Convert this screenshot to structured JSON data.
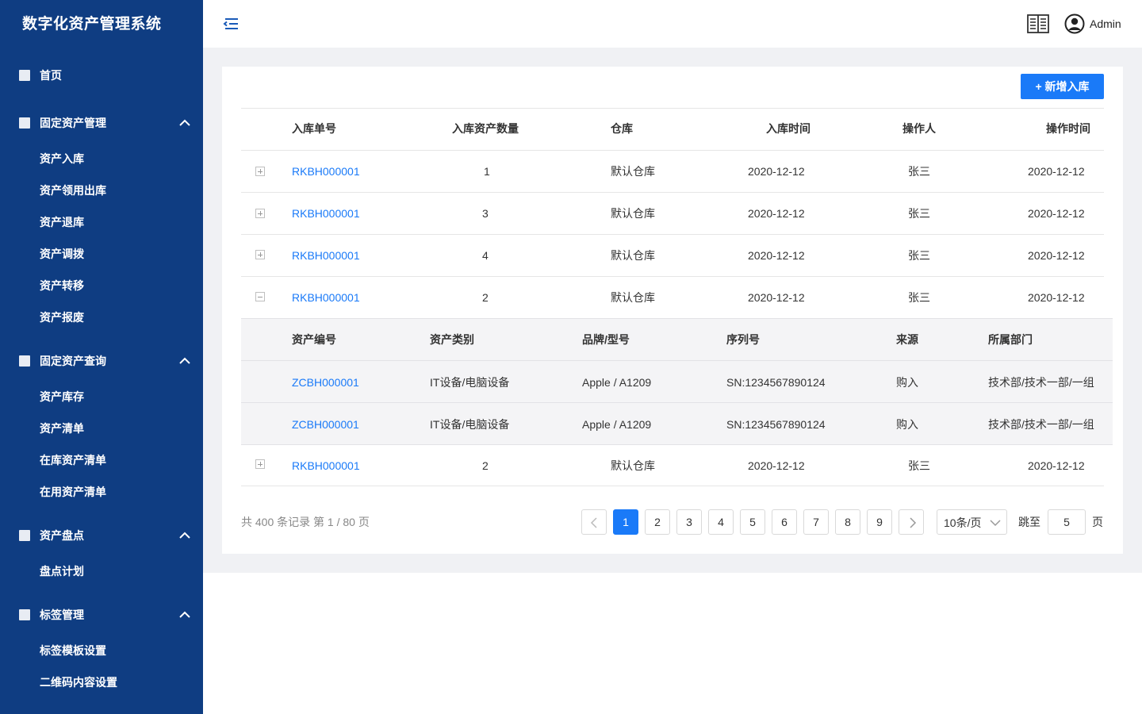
{
  "app": {
    "title": "数字化资产管理系统"
  },
  "sidebar": {
    "home": "首页",
    "groups": [
      {
        "label": "固定资产管理",
        "items": [
          "资产入库",
          "资产领用出库",
          "资产退库",
          "资产调拨",
          "资产转移",
          "资产报废"
        ]
      },
      {
        "label": "固定资产查询",
        "items": [
          "资产库存",
          "资产清单",
          "在库资产清单",
          "在用资产清单"
        ]
      },
      {
        "label": "资产盘点",
        "items": [
          "盘点计划"
        ]
      },
      {
        "label": "标签管理",
        "items": [
          "标签模板设置",
          "二维码内容设置"
        ]
      }
    ]
  },
  "header": {
    "user": "Admin",
    "icons": [
      "menu-collapse-icon",
      "book-icon",
      "user-avatar-icon"
    ]
  },
  "toolbar": {
    "add_label": "+  新增入库"
  },
  "table": {
    "columns": [
      "入库单号",
      "入库资产数量",
      "仓库",
      "入库时间",
      "操作人",
      "操作时间"
    ],
    "rows": [
      {
        "id": "RKBH000001",
        "qty": "1",
        "warehouse": "默认仓库",
        "in_time": "2020-12-12",
        "operator": "张三",
        "op_time": "2020-12-12",
        "expanded": false
      },
      {
        "id": "RKBH000001",
        "qty": "3",
        "warehouse": "默认仓库",
        "in_time": "2020-12-12",
        "operator": "张三",
        "op_time": "2020-12-12",
        "expanded": false
      },
      {
        "id": "RKBH000001",
        "qty": "4",
        "warehouse": "默认仓库",
        "in_time": "2020-12-12",
        "operator": "张三",
        "op_time": "2020-12-12",
        "expanded": false
      },
      {
        "id": "RKBH000001",
        "qty": "2",
        "warehouse": "默认仓库",
        "in_time": "2020-12-12",
        "operator": "张三",
        "op_time": "2020-12-12",
        "expanded": true
      },
      {
        "id": "RKBH000001",
        "qty": "2",
        "warehouse": "默认仓库",
        "in_time": "2020-12-12",
        "operator": "张三",
        "op_time": "2020-12-12",
        "expanded": false
      }
    ],
    "sub": {
      "columns": [
        "资产编号",
        "资产类别",
        "品牌/型号",
        "序列号",
        "来源",
        "所属部门"
      ],
      "rows": [
        {
          "code": "ZCBH000001",
          "category": "IT设备/电脑设备",
          "brand": "Apple / A1209",
          "serial": "SN:1234567890124",
          "source": "购入",
          "dept": "技术部/技术一部/一组"
        },
        {
          "code": "ZCBH000001",
          "category": "IT设备/电脑设备",
          "brand": "Apple / A1209",
          "serial": "SN:1234567890124",
          "source": "购入",
          "dept": "技术部/技术一部/一组"
        }
      ]
    }
  },
  "pagination": {
    "summary": "共 400 条记录 第 1 / 80 页",
    "pages": [
      "1",
      "2",
      "3",
      "4",
      "5",
      "6",
      "7",
      "8",
      "9"
    ],
    "current": "1",
    "page_size": "10条/页",
    "jump_label": "跳至",
    "jump_value": "5",
    "jump_suffix": "页"
  },
  "colors": {
    "sidebar": "#0f3d82",
    "accent": "#1a7af8",
    "content_bg": "#f0f1f4"
  }
}
